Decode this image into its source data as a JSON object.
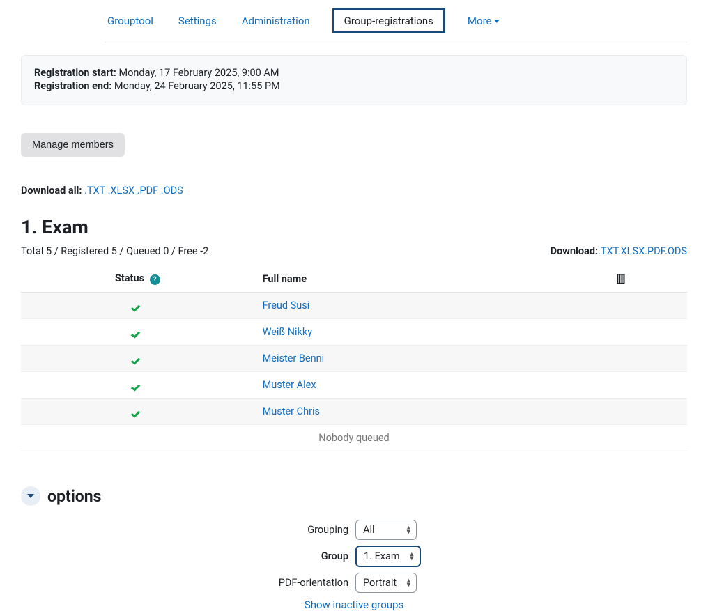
{
  "tabs": {
    "grouptool": "Grouptool",
    "settings": "Settings",
    "administration": "Administration",
    "registrations": "Group-registrations",
    "more": "More"
  },
  "info": {
    "reg_start_label": "Registration start:",
    "reg_start_value": "Monday, 17 February 2025, 9:00 AM",
    "reg_end_label": "Registration end:",
    "reg_end_value": "Monday, 24 February 2025, 11:55 PM"
  },
  "buttons": {
    "manage_members": "Manage members"
  },
  "download_all": {
    "label": "Download all:",
    "txt": ".TXT",
    "xlsx": ".XLSX",
    "pdf": ".PDF",
    "ods": ".ODS"
  },
  "section": {
    "title": "1. Exam",
    "stats": "Total 5 / Registered 5 / Queued 0 / Free -2",
    "download_label": "Download:",
    "dl_txt": ".TXT",
    "dl_xlsx": ".XLSX",
    "dl_pdf": ".PDF",
    "dl_ods": ".ODS"
  },
  "table": {
    "status_header": "Status",
    "name_header": "Full name",
    "actions_header": "[[]]",
    "rows": [
      {
        "name": "Freud Susi"
      },
      {
        "name": "Weiß Nikky"
      },
      {
        "name": "Meister Benni"
      },
      {
        "name": "Muster Alex"
      },
      {
        "name": "Muster Chris"
      }
    ],
    "nobody_queued": "Nobody queued"
  },
  "options": {
    "heading": "options",
    "grouping_label": "Grouping",
    "grouping_value": "All",
    "group_label": "Group",
    "group_value": "1. Exam",
    "pdf_label": "PDF-orientation",
    "pdf_value": "Portrait",
    "show_inactive": "Show inactive groups"
  }
}
